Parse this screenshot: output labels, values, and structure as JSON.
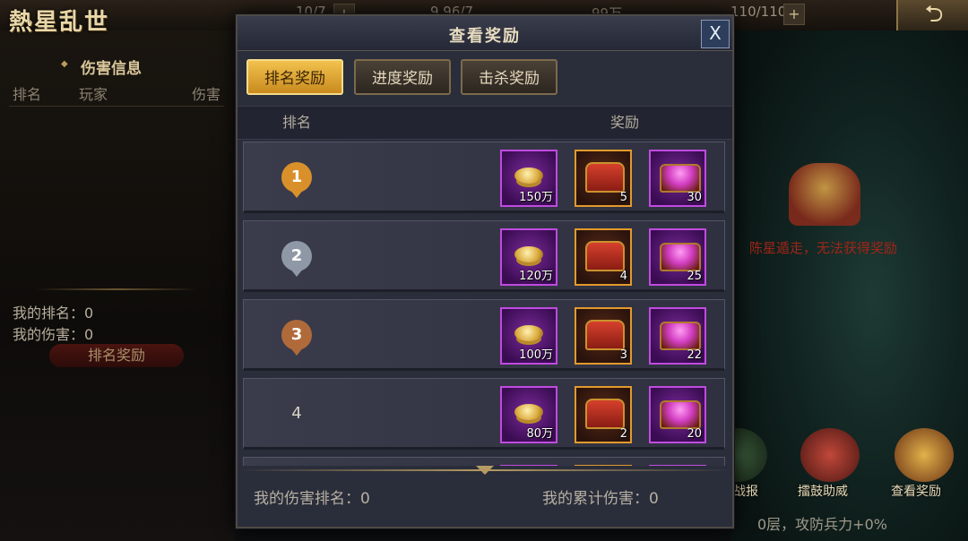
{
  "game": {
    "logo": "熱星乱世"
  },
  "hud": {
    "res1": "10/7",
    "res2": "9.96/7",
    "res3": "99万",
    "res4": "110/110",
    "plus": "+"
  },
  "back_button": {
    "icon": "back-arrow-icon",
    "glyph": "⮌"
  },
  "side_panel": {
    "title": "伤害信息",
    "columns": [
      "排名",
      "玩家",
      "伤害"
    ],
    "my_rank": "我的排名：0",
    "my_damage": "我的伤害：0",
    "rank_reward_button": "排名奖励"
  },
  "right_panel": {
    "warning": "陈星遁走，无法获得奖励",
    "actions": [
      {
        "label": "战报",
        "icon": "battle-report-icon"
      },
      {
        "label": "擂鼓助威",
        "icon": "drum-icon"
      },
      {
        "label": "查看奖励",
        "icon": "reward-chest-icon"
      }
    ],
    "status": "0层，攻防兵力+0%"
  },
  "dialog": {
    "title": "查看奖励",
    "close": "X",
    "tabs": [
      {
        "label": "排名奖励",
        "active": true
      },
      {
        "label": "进度奖励",
        "active": false
      },
      {
        "label": "击杀奖励",
        "active": false
      }
    ],
    "col_rank": "排名",
    "col_reward": "奖励",
    "rows": [
      {
        "rank": "1",
        "badge": "gold",
        "rewards": [
          "150万",
          "5",
          "30"
        ]
      },
      {
        "rank": "2",
        "badge": "silver",
        "rewards": [
          "120万",
          "4",
          "25"
        ]
      },
      {
        "rank": "3",
        "badge": "bronze",
        "rewards": [
          "100万",
          "3",
          "22"
        ]
      },
      {
        "rank": "4",
        "badge": "none",
        "rewards": [
          "80万",
          "2",
          "20"
        ]
      }
    ],
    "reward_types": [
      {
        "name": "coins",
        "icon": "copper-coin-icon",
        "frame": "purple"
      },
      {
        "name": "red-chest",
        "icon": "treasure-chest-icon",
        "frame": "orange"
      },
      {
        "name": "gem-chest",
        "icon": "gem-chest-icon",
        "frame": "purple"
      }
    ],
    "footer": {
      "damage_rank": "我的伤害排名：0",
      "total_damage": "我的累计伤害：0"
    }
  },
  "colors": {
    "tab_active": "#f1c24e",
    "purple_frame": "#c04be0",
    "orange_frame": "#e39a2c",
    "gold_badge": "#d9902a",
    "silver_badge": "#8f98a6",
    "bronze_badge": "#b06a3a"
  }
}
